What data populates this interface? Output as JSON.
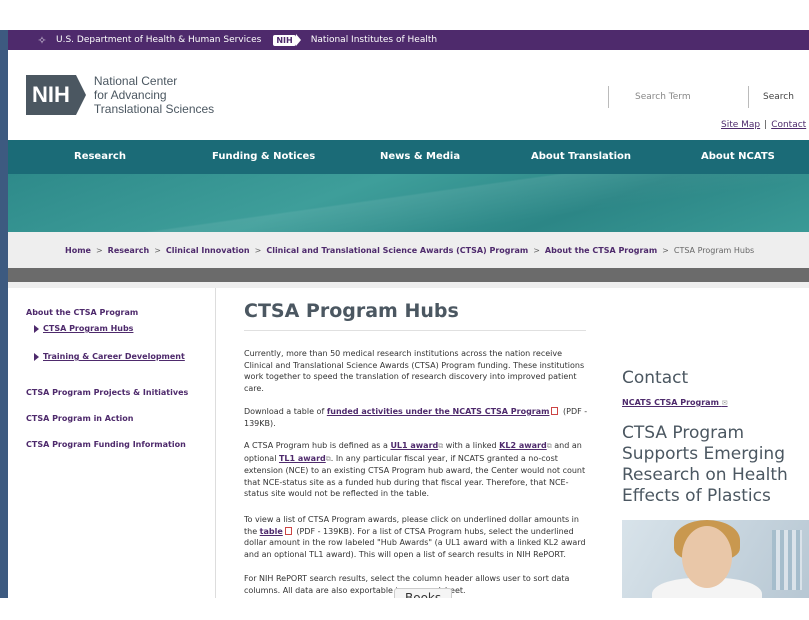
{
  "hhs": {
    "department": "U.S. Department of Health & Human Services",
    "nih_badge": "NIH",
    "nih_name": "National Institutes of Health"
  },
  "header": {
    "logo_text": "NIH",
    "center_name": [
      "National Center",
      "for Advancing",
      "Translational Sciences"
    ],
    "search_placeholder": "Search Term",
    "search_button": "Search",
    "site_map": "Site Map",
    "separator": "|",
    "contact": "Contact"
  },
  "nav": [
    "Research",
    "Funding & Notices",
    "News & Media",
    "About Translation",
    "About NCATS"
  ],
  "breadcrumb": {
    "links": [
      "Home",
      "Research",
      "Clinical Innovation",
      "Clinical and Translational Science Awards (CTSA) Program",
      "About the CTSA Program"
    ],
    "current": "CTSA Program Hubs",
    "sep": ">"
  },
  "sidebar": {
    "items": [
      "About the CTSA Program",
      "CTSA Program Projects & Initiatives",
      "CTSA Program in Action",
      "CTSA Program Funding Information"
    ],
    "subitems": [
      "CTSA Program Hubs",
      "Training & Career Development"
    ]
  },
  "main": {
    "title": "CTSA Program Hubs",
    "p1": "Currently, more than 50 medical research institutions across the nation receive Clinical and Translational Science Awards (CTSA) Program funding. These institutions work together to speed the translation of research discovery into improved patient care.",
    "p2_pre": "Download a table of ",
    "p2_link": "funded activities under the NCATS CTSA Program",
    "p2_post": " (PDF - 139KB).",
    "p3_a": "A CTSA Program hub is defined as a ",
    "p3_link1": "UL1 award",
    "p3_b": " with a linked ",
    "p3_link2": "KL2 award",
    "p3_c": " and an optional ",
    "p3_link3": "TL1 award",
    "p3_d": ". In any particular fiscal year, if NCATS granted a no-cost extension (NCE) to an existing CTSA Program hub award, the Center would not count that NCE-status site as a funded hub during that fiscal year. Therefore, that NCE-status site would not be reflected in the table.",
    "p4_a": "To view a list of CTSA Program awards, please click on underlined dollar amounts in the ",
    "p4_link": "table",
    "p4_b": " (PDF - 139KB). For a list of CTSA Program hubs, select the underlined dollar amount in the row labeled \"Hub Awards\" (a UL1 award with a linked KL2 award and an optional TL1 award). This will open a list of search results in NIH RePORT.",
    "p5": "For NIH RePORT search results, select the column header allows user to sort data columns. All data are also exportable to a spreadsheet."
  },
  "right": {
    "contact_heading": "Contact",
    "contact_link": "NCATS CTSA Program",
    "promo_heading": "CTSA Program Supports Emerging Research on Health Effects of Plastics"
  },
  "tooltip": "Books",
  "icons": {
    "hhs": "eagle-icon",
    "external": "external-link-icon",
    "pdf": "pdf-icon",
    "mail": "mail-icon"
  },
  "colors": {
    "purple": "#4e2a6c",
    "teal": "#1b6b77",
    "frame": "#3d5a80"
  }
}
